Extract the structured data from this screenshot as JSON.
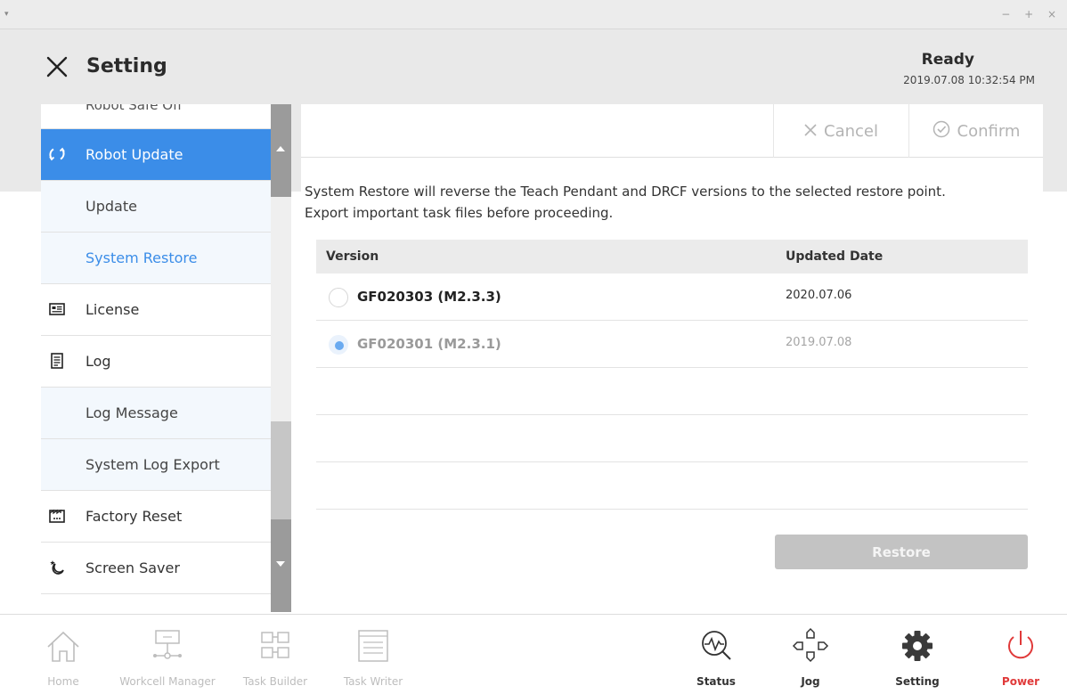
{
  "window": {
    "menu_glyph": "▾",
    "controls": "− + ×"
  },
  "header": {
    "title": "Setting",
    "status": "Ready",
    "timestamp": "2019.07.08 10:32:54 PM"
  },
  "sidebar": {
    "partial_item": "Robot Safe Off",
    "items": [
      {
        "label": "Robot Update",
        "icon": "refresh-icon",
        "state": "active"
      },
      {
        "label": "Update",
        "state": "sub"
      },
      {
        "label": "System Restore",
        "state": "sub-current"
      },
      {
        "label": "License",
        "icon": "license-card-icon"
      },
      {
        "label": "Log",
        "icon": "log-document-icon"
      },
      {
        "label": "Log Message",
        "state": "sub"
      },
      {
        "label": "System Log Export",
        "state": "sub"
      },
      {
        "label": "Factory Reset",
        "icon": "factory-reset-icon"
      },
      {
        "label": "Screen Saver",
        "icon": "moon-star-icon"
      }
    ]
  },
  "toolbar": {
    "cancel_label": "Cancel",
    "confirm_label": "Confirm"
  },
  "main": {
    "description_line1": "System Restore will reverse the Teach Pendant and DRCF versions to the selected restore point.",
    "description_line2": "Export important task files before proceeding.",
    "table": {
      "headers": [
        "Version",
        "Updated Date"
      ],
      "rows": [
        {
          "version": "GF020303 (M2.3.3)",
          "date": "2020.07.06",
          "selected": false
        },
        {
          "version": "GF020301 (M2.3.1)",
          "date": "2019.07.08",
          "selected": true
        }
      ]
    },
    "restore_label": "Restore"
  },
  "bottom_nav": [
    {
      "label": "Home",
      "icon": "home-icon",
      "enabled": false
    },
    {
      "label": "Workcell Manager",
      "icon": "workcell-icon",
      "enabled": false
    },
    {
      "label": "Task Builder",
      "icon": "task-builder-icon",
      "enabled": false
    },
    {
      "label": "Task Writer",
      "icon": "task-writer-icon",
      "enabled": false
    },
    {
      "label": "Status",
      "icon": "status-icon",
      "enabled": true
    },
    {
      "label": "Jog",
      "icon": "jog-icon",
      "enabled": true
    },
    {
      "label": "Setting",
      "icon": "gear-icon",
      "enabled": true
    },
    {
      "label": "Power",
      "icon": "power-icon",
      "enabled": true
    }
  ],
  "colors": {
    "accent": "#3b8de8",
    "power": "#e03a3a",
    "disabled": "#c3c3c3"
  }
}
